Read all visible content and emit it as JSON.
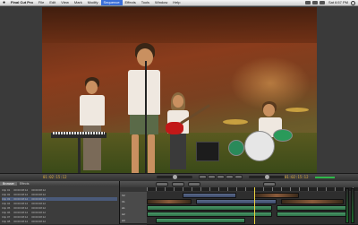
{
  "menubar": {
    "apple": "",
    "items": [
      "Final Cut Pro",
      "File",
      "Edit",
      "View",
      "Mark",
      "Modify",
      "Sequence",
      "Effects",
      "Tools",
      "Window",
      "Help"
    ],
    "open_index": 6,
    "clock": "Sat 6:57 PM"
  },
  "canvas": {
    "timecode_left": "01:02:15:12",
    "timecode_right": "01:02:15:12"
  },
  "browser": {
    "tabs": [
      "Browser",
      "Effects"
    ],
    "rows": [
      [
        "Clip 01",
        "00:00:08:12",
        "00:00:08:12"
      ],
      [
        "Clip 02",
        "00:00:08:12",
        "00:00:08:12"
      ],
      [
        "Clip 03",
        "00:00:08:12",
        "00:00:08:12"
      ],
      [
        "Clip 04",
        "00:00:08:12",
        "00:00:08:12"
      ],
      [
        "Clip 05",
        "00:00:08:12",
        "00:00:08:12"
      ],
      [
        "Clip 06",
        "00:00:08:12",
        "00:00:08:12"
      ],
      [
        "Clip 07",
        "00:00:08:12",
        "00:00:08:12"
      ],
      [
        "Clip 08",
        "00:00:08:12",
        "00:00:08:12"
      ]
    ]
  },
  "timeline": {
    "tracks": [
      {
        "label": "V2",
        "type": "video"
      },
      {
        "label": "V1",
        "type": "video"
      },
      {
        "label": "A1",
        "type": "audio"
      },
      {
        "label": "A2",
        "type": "audio"
      },
      {
        "label": "A3",
        "type": "audio"
      }
    ]
  },
  "colors": {
    "accent": "#3a6fd8",
    "timecode": "#e0b040",
    "render_bar": "#2fb84a",
    "playhead": "#e8d040"
  }
}
